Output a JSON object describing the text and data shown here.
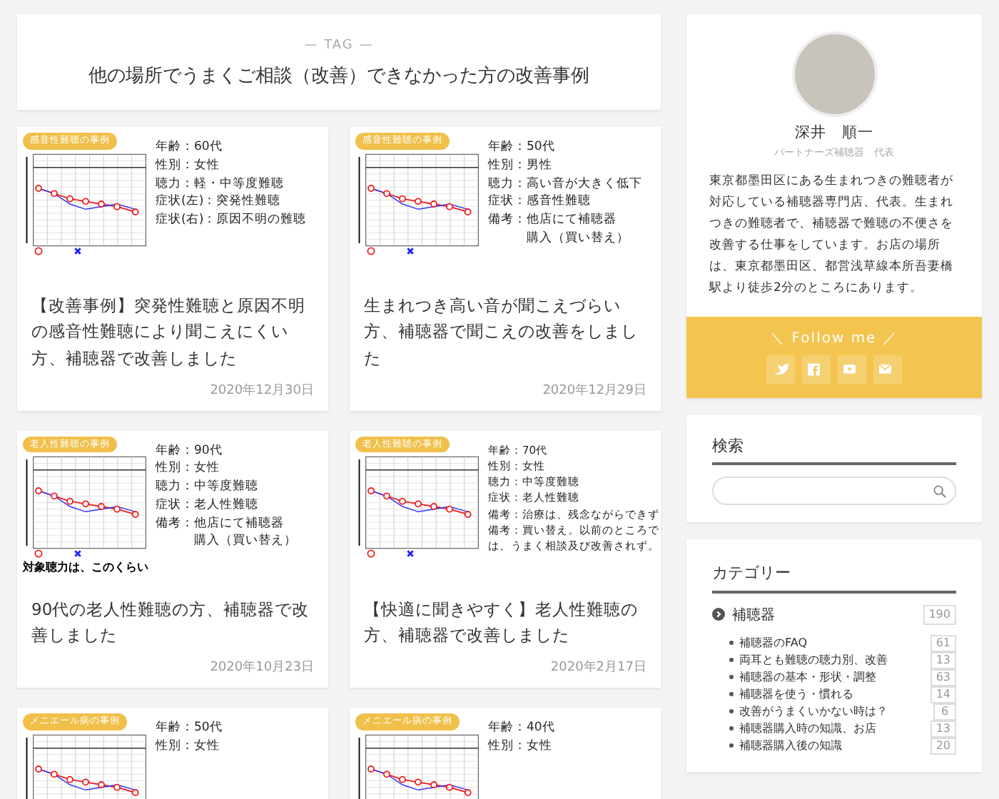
{
  "header": {
    "kicker": "— TAG —",
    "title": "他の場所でうまくご相談（改善）できなかった方の改善事例"
  },
  "posts": [
    {
      "badge": "感音性難聴の事例",
      "lines": [
        "年齢：60代",
        "性別：女性",
        "聴力：軽・中等度難聴",
        "症状(左)：突発性難聴",
        "症状(右)：原因不明の難聴"
      ],
      "title": "【改善事例】突発性難聴と原因不明の感音性難聴により聞こえにくい方、補聴器で改善しました",
      "date": "2020年12月30日"
    },
    {
      "badge": "感音性難聴の事例",
      "lines": [
        "年齢：50代",
        "性別：男性",
        "聴力：高い音が大きく低下",
        "症状：感音性難聴",
        "備考：他店にて補聴器",
        "　　　購入（買い替え）"
      ],
      "title": "生まれつき高い音が聞こえづらい方、補聴器で聞こえの改善をしました",
      "date": "2020年12月29日"
    },
    {
      "badge": "老人性難聴の事例",
      "lines": [
        "年齢：90代",
        "性別：女性",
        "聴力：中等度難聴",
        "症状：老人性難聴",
        "備考：他店にて補聴器",
        "　　　購入（買い替え）"
      ],
      "caption": "対象聴力は、このくらい",
      "title": "90代の老人性難聴の方、補聴器で改善しました",
      "date": "2020年10月23日"
    },
    {
      "badge": "老人性難聴の事例",
      "lines": [
        "年齢：70代",
        "性別：女性",
        "聴力：中等度難聴",
        "症状：老人性難聴",
        "備考：治療は、残念ながらできず",
        "備考：買い替え。以前のところで",
        "は、うまく相談及び改善されず。"
      ],
      "title": "【快適に聞きやすく】老人性難聴の方、補聴器で改善しました",
      "date": "2020年2月17日"
    },
    {
      "badge": "メニエール病の事例",
      "lines": [
        "年齢：50代",
        "性別：女性"
      ]
    },
    {
      "badge": "メニエール病の事例",
      "lines": [
        "年齢：40代",
        "性別：女性"
      ]
    }
  ],
  "profile": {
    "name": "深井　順一",
    "role": "パートナーズ補聴器　代表",
    "bio": "東京都墨田区にある生まれつきの難聴者が対応している補聴器専門店、代表。生まれつきの難聴者で、補聴器で難聴の不便さを改善する仕事をしています。お店の場所は、東京都墨田区、都営浅草線本所吾妻橋駅より徒歩2分のところにあります。",
    "follow": "＼ Follow me ／",
    "social": [
      {
        "kind": "bird"
      },
      {
        "kind": "f"
      },
      {
        "kind": "play"
      },
      {
        "kind": "mail"
      }
    ]
  },
  "search": {
    "heading": "検索"
  },
  "categories": {
    "heading": "カテゴリー",
    "items": [
      {
        "label": "補聴器",
        "count": "190",
        "children": [
          {
            "label": "補聴器のFAQ",
            "count": "61"
          },
          {
            "label": "両耳とも難聴の聴力別、改善",
            "count": "13"
          },
          {
            "label": "補聴器の基本・形状・調整",
            "count": "63"
          },
          {
            "label": "補聴器を使う・慣れる",
            "count": "14"
          },
          {
            "label": "改善がうまくいかない時は？",
            "count": "6"
          },
          {
            "label": "補聴器購入時の知識、お店",
            "count": "13"
          },
          {
            "label": "補聴器購入後の知識",
            "count": "20"
          }
        ]
      }
    ]
  }
}
